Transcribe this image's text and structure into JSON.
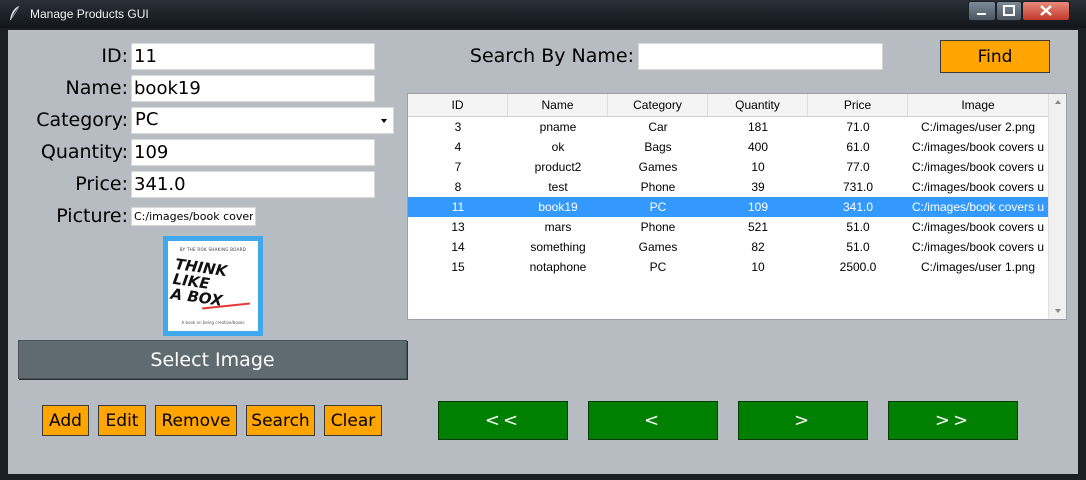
{
  "window": {
    "title": "Manage Products GUI"
  },
  "form": {
    "id_label": "ID:",
    "id_value": "11",
    "name_label": "Name:",
    "name_value": "book19",
    "category_label": "Category:",
    "category_value": "PC",
    "quantity_label": "Quantity:",
    "quantity_value": "109",
    "price_label": "Price:",
    "price_value": "341.0",
    "picture_label": "Picture:",
    "picture_value": "C:/images/book covers"
  },
  "thumbnail": {
    "top_text": "BY THE ROK SHAKING BOARD",
    "title_lines": "THINK LIKE A BOX",
    "subtitle": "A book on being creative/boxes"
  },
  "select_image_label": "Select Image",
  "actions": {
    "add": "Add",
    "edit": "Edit",
    "remove": "Remove",
    "search": "Search",
    "clear": "Clear"
  },
  "search": {
    "label": "Search By Name:",
    "value": "",
    "find_label": "Find"
  },
  "nav": {
    "first": "<<",
    "prev": "<",
    "next": ">",
    "last": ">>"
  },
  "table": {
    "columns": [
      "ID",
      "Name",
      "Category",
      "Quantity",
      "Price",
      "Image"
    ],
    "selected_index": 4,
    "rows": [
      [
        "3",
        "pname",
        "Car",
        "181",
        "71.0",
        "C:/images/user 2.png"
      ],
      [
        "4",
        "ok",
        "Bags",
        "400",
        "61.0",
        "C:/images/book covers u"
      ],
      [
        "7",
        "product2",
        "Games",
        "10",
        "77.0",
        "C:/images/book covers u"
      ],
      [
        "8",
        "test",
        "Phone",
        "39",
        "731.0",
        "C:/images/book covers u"
      ],
      [
        "11",
        "book19",
        "PC",
        "109",
        "341.0",
        "C:/images/book covers u"
      ],
      [
        "13",
        "mars",
        "Phone",
        "521",
        "51.0",
        "C:/images/book covers u"
      ],
      [
        "14",
        "something",
        "Games",
        "82",
        "51.0",
        "C:/images/book covers u"
      ],
      [
        "15",
        "notaphone",
        "PC",
        "10",
        "2500.0",
        "C:/images/user 1.png"
      ]
    ]
  },
  "colors": {
    "background": "#b6bcc1",
    "orange": "#ffa500",
    "green": "#008000",
    "select_image": "#606b71",
    "selection": "#3399ff"
  }
}
